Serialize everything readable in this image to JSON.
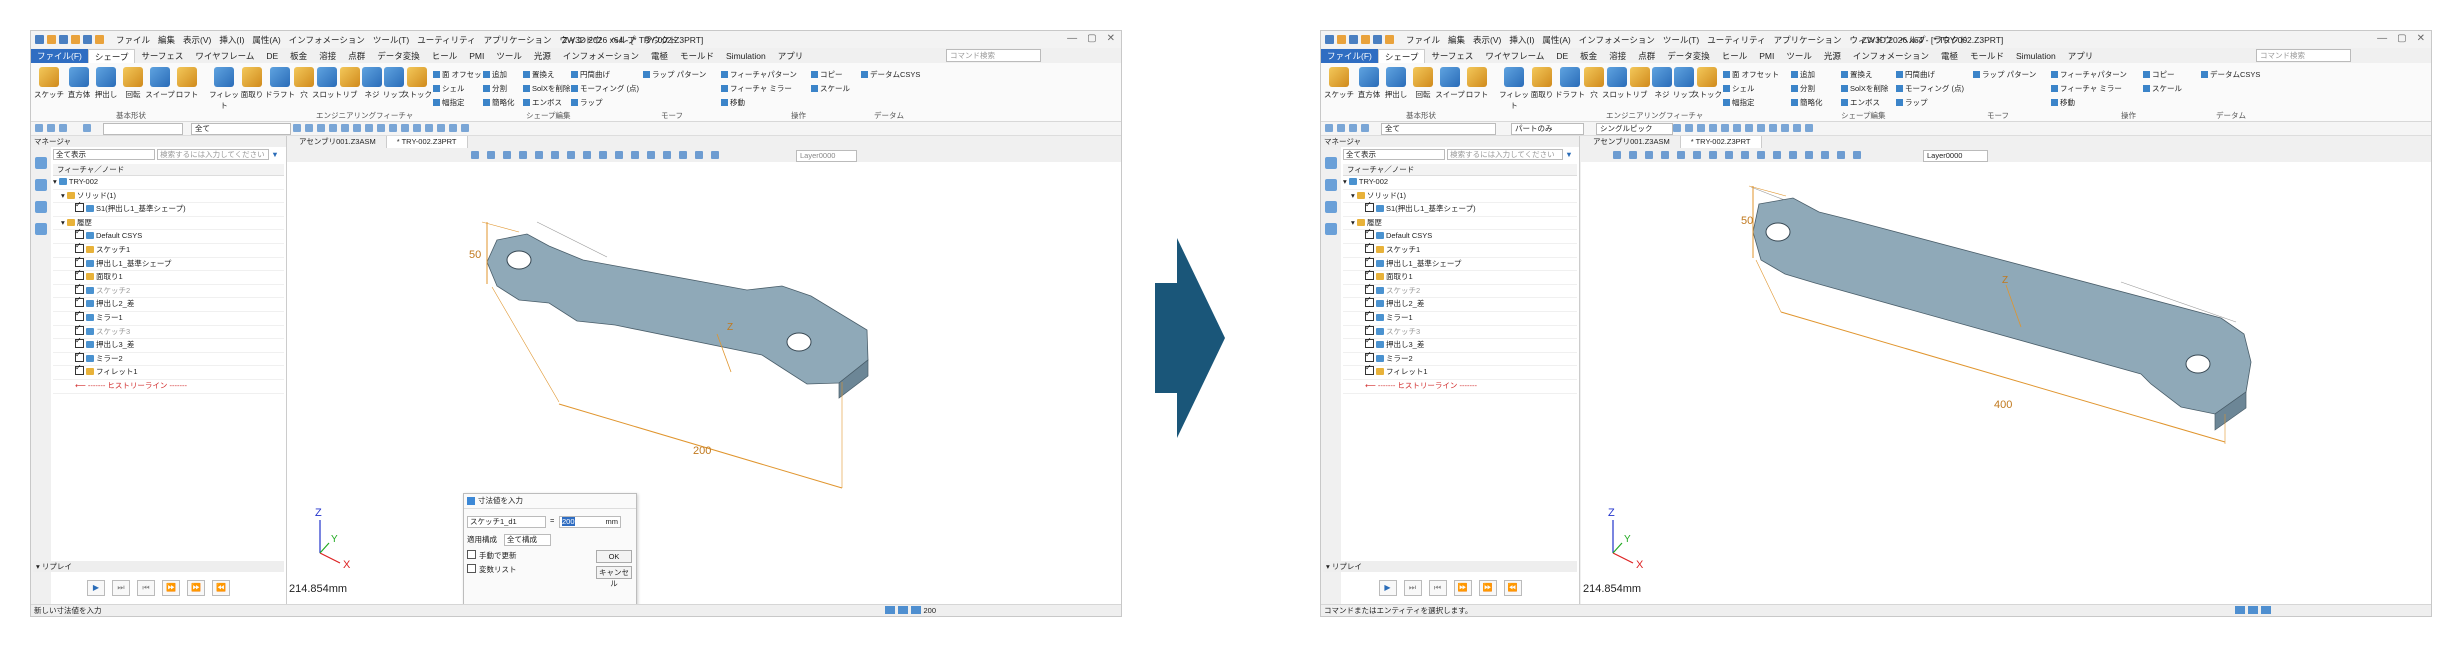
{
  "app_title": "ZW3D 2026 x64 - [* TRY-002.Z3PRT]",
  "menus": [
    "ファイル",
    "編集",
    "表示(V)",
    "挿入(I)",
    "属性(A)",
    "インフォメーション",
    "ツール(T)",
    "ユーティリティ",
    "アプリケーション",
    "ウィンドウ",
    "ヘルプ",
    "ラウクド"
  ],
  "tabs": [
    "ファイル(F)",
    "シェープ",
    "サーフェス",
    "ワイヤフレーム",
    "DE",
    "板金",
    "溶接",
    "点群",
    "データ変換",
    "ヒール",
    "PMI",
    "ツール",
    "光源",
    "インフォメーション",
    "電極",
    "モールド",
    "Simulation",
    "アプリ"
  ],
  "search_placeholder": "コマンド検索",
  "ribbon": {
    "basic": [
      "スケッチ",
      "直方体",
      "押出し",
      "回転",
      "スイープ",
      "ロフト"
    ],
    "eng": [
      "フィレット",
      "面取り",
      "ドラフト",
      "穴",
      "スロット",
      "リブ",
      "ネジ",
      "リップ",
      "ストック"
    ],
    "edit_col1": [
      "面 オフセット",
      "シェル",
      "幅指定"
    ],
    "edit_col2": [
      "追加",
      "分割",
      "簡略化"
    ],
    "edit_col3": [
      "置換え",
      "SolXを削除",
      "エンボス"
    ],
    "edit_col4": [
      "円筒曲げ",
      "モーフィング (点)",
      "ラップ"
    ],
    "edit_col5": [
      "ラップ パターン"
    ],
    "ops_col1": [
      "フィーチャパターン",
      "フィーチャ ミラー",
      "移動"
    ],
    "ops_col2": [
      "コピー",
      "スケール"
    ],
    "datum": [
      "データムCSYS"
    ],
    "groups": [
      "基本形状",
      "エンジニアリングフィーチャ",
      "シェープ編集",
      "モーフ",
      "操作",
      "データム"
    ]
  },
  "filter_left": "全て",
  "filter_right": "シングルピック",
  "filter_right_left": "パートのみ",
  "layer": "Layer0000",
  "manager": {
    "title": "マネージャ",
    "filter": "全て表示",
    "search_placeholder": "検索するには入力してください",
    "tree_header": "フィーチャ／ノード",
    "rows": [
      "TRY-002",
      "ソリッド(1)",
      "S1(押出し1_基準シェープ)",
      "履歴",
      "Default CSYS",
      "スケッチ1",
      "押出し1_基準シェープ",
      "面取り1",
      "スケッチ2",
      "押出し2_差",
      "ミラー1",
      "スケッチ3",
      "押出し3_差",
      "ミラー2",
      "フィレット1",
      "------- ヒストリーライン -------"
    ]
  },
  "replay_label": "リプレイ",
  "doc_tabs": [
    "アセンブリ001.Z3ASM",
    "* TRY-002.Z3PRT"
  ],
  "axis_labels": {
    "z": "Z",
    "y": "Y",
    "x": "X"
  },
  "left": {
    "dim_height": "50",
    "dim_length": "200",
    "measure": "214.854mm",
    "status": "新しい寸法値を入力",
    "status_value": "200",
    "dialog": {
      "title": "寸法値を入力",
      "name": "スケッチ1_d1",
      "eq": "=",
      "value": "200",
      "unit": "mm",
      "apply_label": "適用構成",
      "apply_value": "全て構成",
      "manual": "手動で更新",
      "varlist": "変数リスト",
      "ok": "OK",
      "cancel": "キャンセル"
    }
  },
  "right": {
    "dim_height": "50",
    "dim_length": "400",
    "measure": "214.854mm",
    "status": "コマンドまたはエンティティを選択します。"
  },
  "colors": {
    "accent": "#2f6dc2",
    "part": "#8fa9b8",
    "arrow": "#1a5679",
    "dimension": "#e0952e"
  }
}
